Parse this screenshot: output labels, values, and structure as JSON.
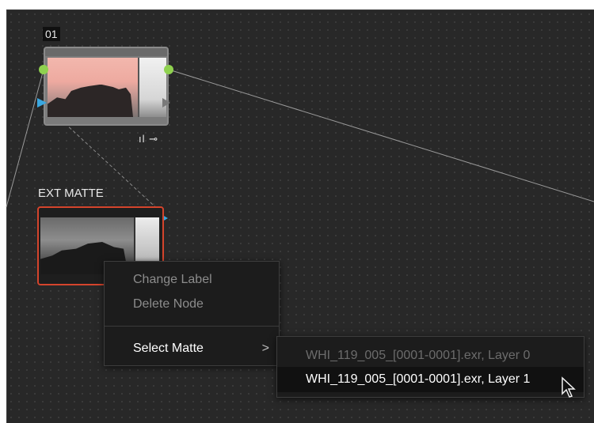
{
  "node_graph": {
    "node01": {
      "id_label": "01",
      "status_icons": "ıl ⊸"
    },
    "ext_matte_node": {
      "label": "EXT MATTE"
    }
  },
  "context_menu": {
    "items": [
      {
        "label": "Change Label",
        "enabled": false
      },
      {
        "label": "Delete Node",
        "enabled": false
      },
      {
        "label": "Select Matte",
        "enabled": true,
        "has_submenu": true,
        "submenu_indicator": ">"
      }
    ]
  },
  "submenu": {
    "items": [
      {
        "label": "WHI_119_005_[0001-0001].exr, Layer 0",
        "enabled": false
      },
      {
        "label": "WHI_119_005_[0001-0001].exr, Layer 1",
        "enabled": true,
        "highlighted": true
      }
    ]
  },
  "colors": {
    "canvas": "#282828",
    "output_port": "#8fd14f",
    "input_port": "#3aa7e0",
    "selected_border": "#d4442c"
  }
}
